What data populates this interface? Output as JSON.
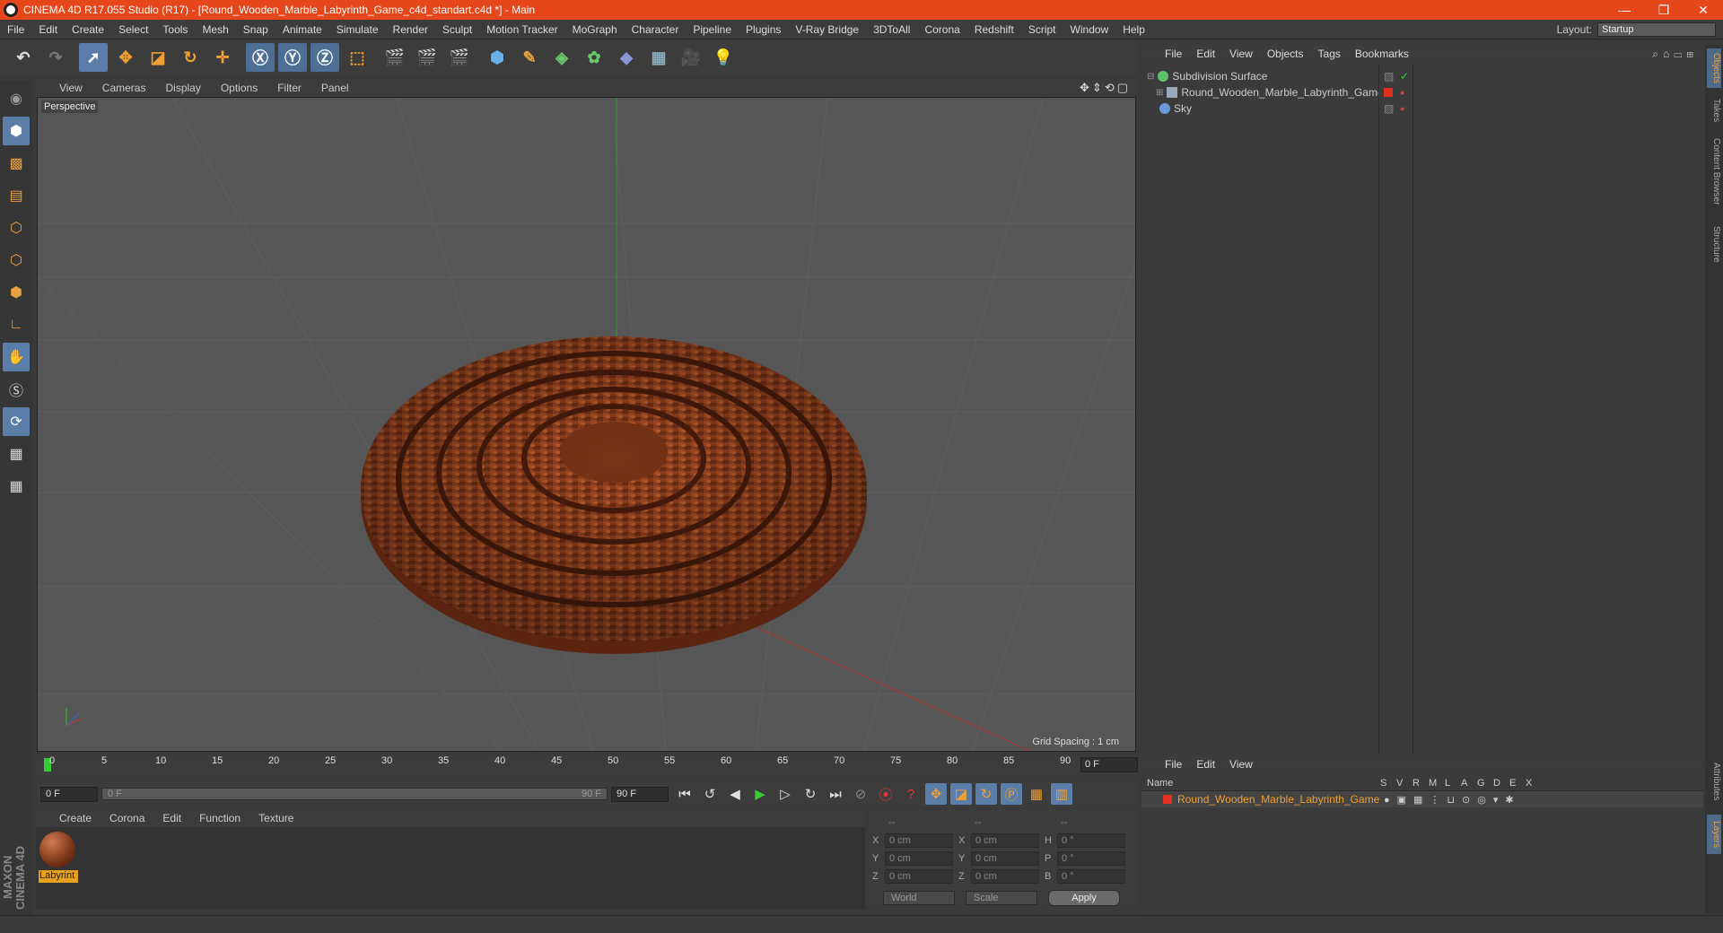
{
  "window": {
    "title": "CINEMA 4D R17.055 Studio (R17) - [Round_Wooden_Marble_Labyrinth_Game_c4d_standart.c4d *] - Main"
  },
  "menubar": {
    "items": [
      "File",
      "Edit",
      "Create",
      "Select",
      "Tools",
      "Mesh",
      "Snap",
      "Animate",
      "Simulate",
      "Render",
      "Sculpt",
      "Motion Tracker",
      "MoGraph",
      "Character",
      "Pipeline",
      "Plugins",
      "V-Ray Bridge",
      "3DToAll",
      "Corona",
      "Redshift",
      "Script",
      "Window",
      "Help"
    ],
    "layout_label": "Layout:",
    "layout_value": "Startup"
  },
  "viewport": {
    "menu": [
      "View",
      "Cameras",
      "Display",
      "Options",
      "Filter",
      "Panel"
    ],
    "label": "Perspective",
    "grid_spacing": "Grid Spacing : 1 cm"
  },
  "timeline": {
    "ticks": [
      "0",
      "5",
      "10",
      "15",
      "20",
      "25",
      "30",
      "35",
      "40",
      "45",
      "50",
      "55",
      "60",
      "65",
      "70",
      "75",
      "80",
      "85",
      "90"
    ],
    "current_frame": "0 F",
    "start_field": "0 F",
    "slider_left": "0 F",
    "slider_right": "90 F",
    "end_field": "90 F"
  },
  "material_manager": {
    "menu": [
      "Create",
      "Corona",
      "Edit",
      "Function",
      "Texture"
    ],
    "material_name": "Labyrint"
  },
  "coordinates": {
    "rows": [
      {
        "a": "X",
        "av": "0 cm",
        "b": "X",
        "bv": "0 cm",
        "c": "H",
        "cv": "0 °"
      },
      {
        "a": "Y",
        "av": "0 cm",
        "b": "Y",
        "bv": "0 cm",
        "c": "P",
        "cv": "0 °"
      },
      {
        "a": "Z",
        "av": "0 cm",
        "b": "Z",
        "bv": "0 cm",
        "c": "B",
        "cv": "0 °"
      }
    ],
    "header": [
      "--",
      "--",
      "--"
    ],
    "mode": "World",
    "transform": "Scale",
    "apply_label": "Apply"
  },
  "object_manager": {
    "menu": [
      "File",
      "Edit",
      "View",
      "Objects",
      "Tags",
      "Bookmarks"
    ],
    "objects": [
      {
        "name": "Subdivision Surface",
        "icon_color": "#5ec46a"
      },
      {
        "name": "Round_Wooden_Marble_Labyrinth_Game",
        "icon_color": "#9ab"
      },
      {
        "name": "Sky",
        "icon_color": "#6a9ad8"
      }
    ]
  },
  "layer_manager": {
    "menu": [
      "File",
      "Edit",
      "View"
    ],
    "columns": [
      "Name",
      "S",
      "V",
      "R",
      "M",
      "L",
      "A",
      "G",
      "D",
      "E",
      "X"
    ],
    "layer_name": "Round_Wooden_Marble_Labyrinth_Game",
    "layer_color": "#e03020"
  },
  "right_tabs": [
    "Objects",
    "Takes",
    "Content Browser",
    "Structure",
    "Attributes",
    "Layers"
  ],
  "brand": "MAXON CINEMA 4D"
}
